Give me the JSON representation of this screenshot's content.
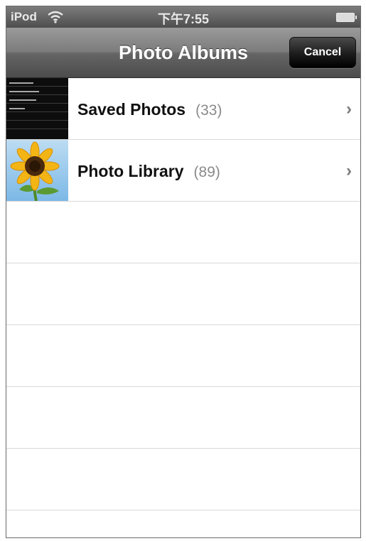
{
  "status_bar": {
    "carrier": "iPod",
    "time": "下午7:55",
    "icons": [
      "wifi-icon",
      "battery-icon"
    ]
  },
  "nav_bar": {
    "title": "Photo Albums",
    "cancel_label": "Cancel"
  },
  "albums": [
    {
      "name": "Saved Photos",
      "count": "(33)",
      "thumbnail": "saved-photos-thumbnail"
    },
    {
      "name": "Photo Library",
      "count": "(89)",
      "thumbnail": "sunflower-thumbnail"
    }
  ],
  "colors": {
    "nav_bar": "#6e6e6e",
    "cancel_button": "#1c1c1c",
    "row_separator": "#d9d9d9",
    "count_text": "#8a8a8a"
  }
}
